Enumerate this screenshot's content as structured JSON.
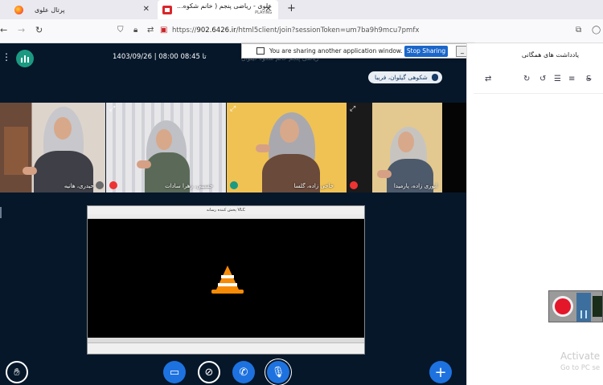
{
  "browser": {
    "tabs": [
      {
        "title": "پرتال علوی",
        "active": false
      },
      {
        "title": "علوی - ریاضی پنجم ( خانم شکوه...",
        "subtitle": "PLAYING",
        "active": true
      }
    ],
    "url_prefix": "https://",
    "url_host": "902.6426.ir",
    "url_path": "/html5client/join?sessionToken=um7ba9h9mcu7pmfx"
  },
  "meeting": {
    "title": "1403/09/26 | 08:00 تا 08:45",
    "title_faded": "ریاضی پنجم خانم شکوه گیلوان",
    "talking": "شکوهی گیلوان، فریبا",
    "sharing_notice": {
      "text": "You are sharing another application window.",
      "stop_label": "Stop Sharing",
      "minimize_label": "_"
    },
    "webcams": [
      {
        "name": "حیدری، هانیه"
      },
      {
        "name": "حسینی، زهرا سادات"
      },
      {
        "name": "حاجی زاده، گلسا"
      },
      {
        "name": "انوری زاده، پارمیدا"
      }
    ],
    "screenshare_window_title": "پخش کننده رسانه VLC"
  },
  "panel": {
    "title": "یادداشت های همگانی"
  },
  "os": {
    "activate_title": "Activate",
    "activate_sub": "Go to PC se"
  },
  "colors": {
    "meeting_bg": "#06172a",
    "primary_blue": "#1d72e0",
    "record_red": "#e3162a",
    "logo_green": "#1b9a82"
  }
}
